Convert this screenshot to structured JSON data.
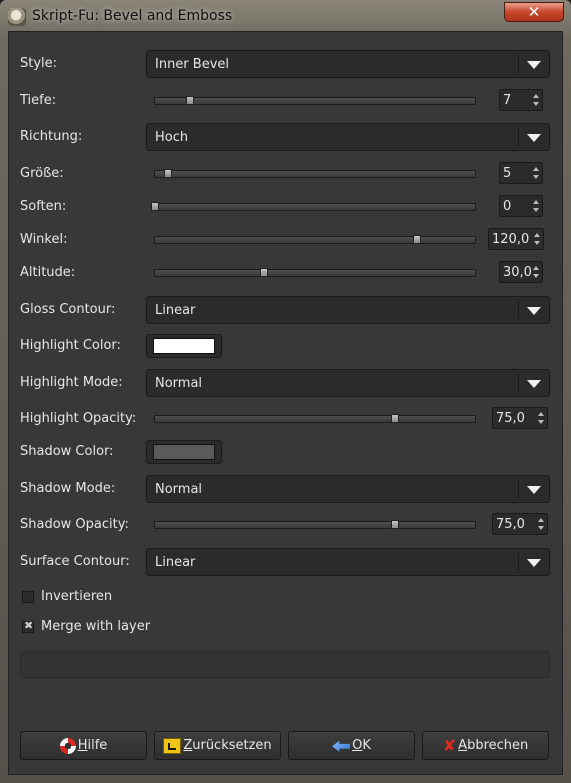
{
  "window": {
    "title": "Skript-Fu: Bevel and Emboss",
    "close_glyph": "✕"
  },
  "style": {
    "label": "Style:",
    "value": "Inner Bevel"
  },
  "tiefe": {
    "label": "Tiefe:",
    "value": "7",
    "level": 0.11
  },
  "richtung": {
    "label": "Richtung:",
    "value": "Hoch"
  },
  "groesse": {
    "label": "Größe:",
    "value": "5",
    "level": 0.04
  },
  "soften": {
    "label": "Soften:",
    "value": "0",
    "level": 0.0
  },
  "winkel": {
    "label": "Winkel:",
    "value": "120,0",
    "level": 0.82
  },
  "altitude": {
    "label": "Altitude:",
    "value": "30,0",
    "level": 0.34
  },
  "gloss_contour": {
    "label": "Gloss Contour:",
    "value": "Linear"
  },
  "highlight_color": {
    "label": "Highlight Color:",
    "color": "#ffffff"
  },
  "highlight_mode": {
    "label": "Highlight Mode:",
    "value": "Normal"
  },
  "highlight_opacity": {
    "label": "Highlight Opacity:",
    "value": "75,0",
    "level": 0.75
  },
  "shadow_color": {
    "label": "Shadow Color:",
    "color": "#5a5a5a"
  },
  "shadow_mode": {
    "label": "Shadow Mode:",
    "value": "Normal"
  },
  "shadow_opacity": {
    "label": "Shadow Opacity:",
    "value": "75,0",
    "level": 0.75
  },
  "surface_contour": {
    "label": "Surface Contour:",
    "value": "Linear"
  },
  "invertieren": {
    "label": "Invertieren",
    "checked": false
  },
  "merge": {
    "label": "Merge with layer",
    "checked": true,
    "mark": "✖"
  },
  "buttons": {
    "hilfe": {
      "first": "H",
      "rest": "ilfe",
      "icon": "lifebuoy-icon"
    },
    "zuruecksetzen": {
      "first": "Z",
      "rest": "urücksetzen",
      "icon": "reset-icon"
    },
    "ok": {
      "first": "O",
      "rest": "K",
      "icon": "ok-arrow-icon"
    },
    "abbrechen": {
      "first": "A",
      "rest": "bbrechen",
      "icon": "cancel-x-icon",
      "glyph": "✘"
    }
  }
}
